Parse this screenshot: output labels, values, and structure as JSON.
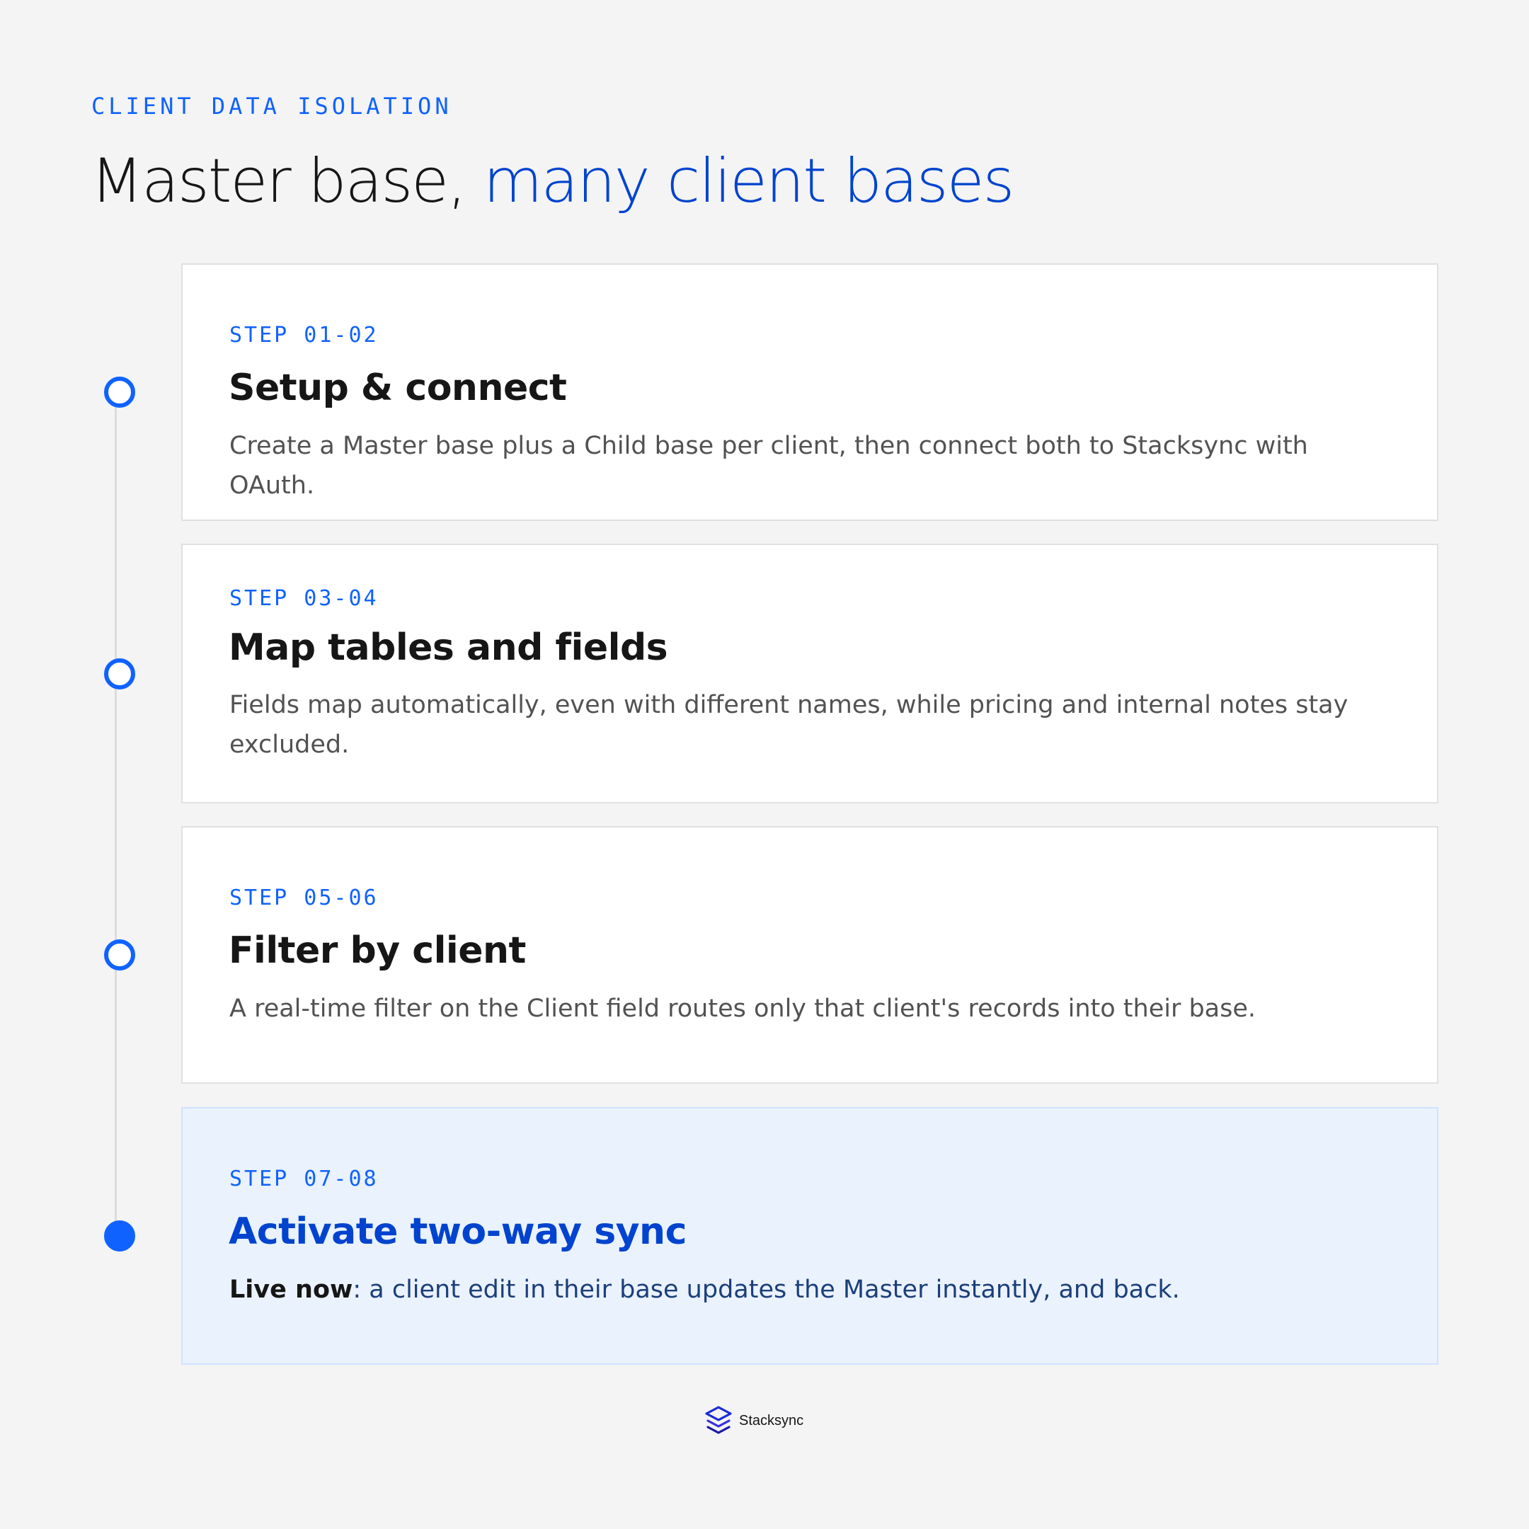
{
  "header": {
    "eyebrow": "CLIENT DATA ISOLATION",
    "title_plain": "Master base,",
    "title_accent": "many client bases"
  },
  "steps": [
    {
      "step": "STEP 01-02",
      "title": "Setup & connect",
      "description": "Create a Master base plus a Child base per client, then connect both to Stacksync with OAuth.",
      "state": "pending"
    },
    {
      "step": "STEP 03-04",
      "title": "Map tables and fields",
      "description": "Fields map automatically, even with different names, while pricing and internal notes stay excluded.",
      "state": "pending"
    },
    {
      "step": "STEP 05-06",
      "title": "Filter by client",
      "description": "A real-time filter on the Client field routes only that client's records into their base.",
      "state": "pending"
    },
    {
      "step": "STEP 07-08",
      "title": "Activate two-way sync",
      "description_strong": "Live now",
      "description": ": a client edit in their base updates the Master instantly, and back.",
      "state": "active"
    }
  ],
  "footer": {
    "brand": "Stacksync",
    "logo_icon": "stacksync-logo-icon"
  },
  "colors": {
    "accent": "#0f62fe",
    "accent_dark": "#0043ce",
    "background": "#f4f4f4",
    "active_card": "#eaf2fe"
  }
}
